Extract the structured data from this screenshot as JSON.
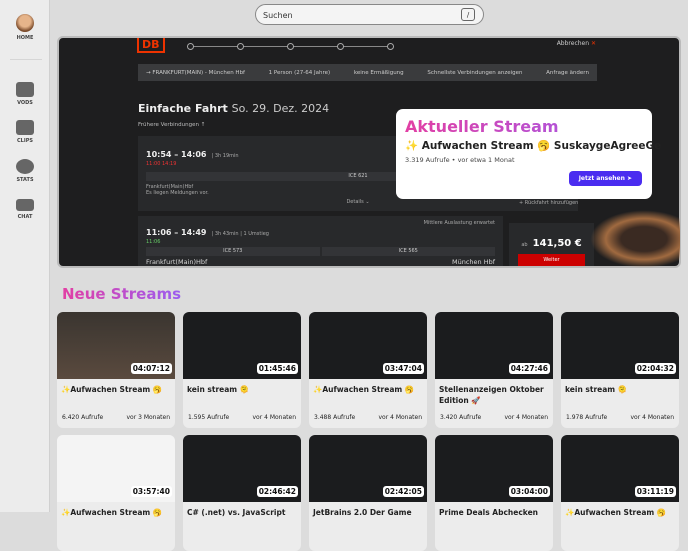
{
  "sidebar": {
    "items": [
      {
        "label": "HOME",
        "icon": "avatar"
      },
      {
        "label": "VODS",
        "icon": "video-camera-icon"
      },
      {
        "label": "CLIPS",
        "icon": "clapperboard-icon"
      },
      {
        "label": "STATS",
        "icon": "pie-chart-icon"
      },
      {
        "label": "CHAT",
        "icon": "keyboard-icon"
      }
    ]
  },
  "search": {
    "placeholder": "Suchen",
    "shortcut": "/"
  },
  "hero": {
    "logo": "DB",
    "cancel": "Abbrechen",
    "route": "→ FRANKFURT(MAIN) - München Hbf",
    "persons": "1 Person (27-64 Jahre)",
    "discount": "keine Ermäßigung",
    "fastest": "Schnellste Verbindungen anzeigen",
    "change": "Anfrage ändern",
    "title": "Einfache Fahrt",
    "date": "So. 29. Dez. 2024",
    "earlier": "Frühere Verbindungen ↑",
    "c1": {
      "time": "10:54 – 14:06",
      "dur": "| 3h 19min",
      "delay": "11:00   14:19",
      "train": "ICE 621",
      "from": "Frankfurt(Main)Hbf",
      "notice": "Es liegen Meldungen vor.",
      "details": "Details ⌄",
      "return": "+ Rückfahrt hinzufügen"
    },
    "c2": {
      "time": "11:06 – 14:49",
      "dur": "| 3h 43min | 1 Umstieg",
      "actual": "11:06",
      "load": "Mittlere Auslastung erwartet",
      "t1": "ICE 573",
      "t2": "ICE 565",
      "from": "Frankfurt(Main)Hbf",
      "to": "München Hbf",
      "price_prefix": "ab",
      "price": "141,50 €",
      "next": "Weiter"
    }
  },
  "popup": {
    "heading": "Aktueller Stream",
    "title": "✨ Aufwachen Stream 🥱 SuskaygeAgreeGe",
    "meta": "3.319 Aufrufe  •  vor etwa 1 Monat",
    "button": "Jetzt ansehen ➤"
  },
  "section": "Neue Streams",
  "streams": [
    {
      "title": "✨Aufwachen Stream 🥱",
      "duration": "04:07:12",
      "views": "6.420 Aufrufe",
      "age": "vor 3 Monaten"
    },
    {
      "title": "kein stream 🫠",
      "duration": "01:45:46",
      "views": "1.595 Aufrufe",
      "age": "vor 4 Monaten"
    },
    {
      "title": "✨Aufwachen Stream 🥱",
      "duration": "03:47:04",
      "views": "3.488 Aufrufe",
      "age": "vor 4 Monaten"
    },
    {
      "title": "Stellenanzeigen Oktober Edition 🚀",
      "duration": "04:27:46",
      "views": "3.420 Aufrufe",
      "age": "vor 4 Monaten"
    },
    {
      "title": "kein stream 🫠",
      "duration": "02:04:32",
      "views": "1.978 Aufrufe",
      "age": "vor 4 Monaten"
    },
    {
      "title": "✨Aufwachen Stream 🥱",
      "duration": "03:57:40"
    },
    {
      "title": "C# (.net) vs. JavaScript",
      "duration": "02:46:42"
    },
    {
      "title": "JetBrains 2.0 Der Game",
      "duration": "02:42:05"
    },
    {
      "title": "Prime Deals Abchecken",
      "duration": "03:04:00"
    },
    {
      "title": "✨Aufwachen Stream 🥱",
      "duration": "03:11:19"
    }
  ]
}
